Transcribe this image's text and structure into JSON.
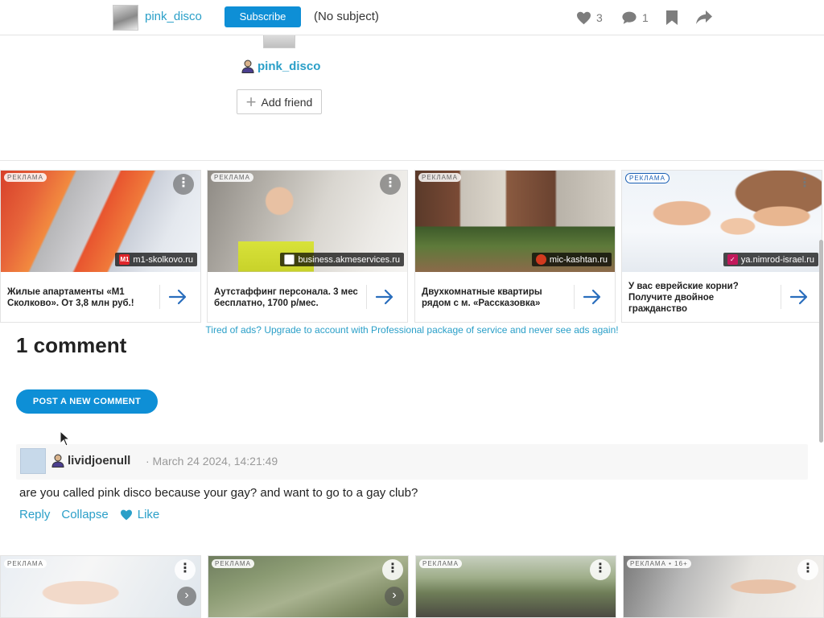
{
  "topbar": {
    "username": "pink_disco",
    "subscribe_label": "Subscribe",
    "subject": "(No subject)",
    "likes_count": "3",
    "comments_count": "1",
    "icons": [
      "heart-icon",
      "comment-icon",
      "bookmark-icon",
      "share-icon"
    ]
  },
  "profile": {
    "name": "pink_disco",
    "add_friend_label": "Add friend"
  },
  "ads": [
    {
      "tag": "РЕКЛАМА",
      "domain": "m1-skolkovo.ru",
      "logo": "M1",
      "logo_color": "#e0242b",
      "title": "Жилые апартаменты «М1 Сколково». От 3,8 млн руб.!"
    },
    {
      "tag": "РЕКЛАМА",
      "domain": "business.akmeservices.ru",
      "logo": "",
      "logo_color": "#ffffff",
      "title": "Аутстаффинг персонала. 3 мес бесплатно, 1700 р/мес."
    },
    {
      "tag": "РЕКЛАМА",
      "domain": "mic-kashtan.ru",
      "logo": "",
      "logo_color": "#d23a1e",
      "title": "Двухкомнатные квартиры рядом с м. «Рассказовка»"
    },
    {
      "tag": "РЕКЛАМА",
      "domain": "ya.nimrod-israel.ru",
      "logo": "✓",
      "logo_color": "#c2185b",
      "title": "У вас еврейские корни? Получите двойное гражданство"
    }
  ],
  "ad_note": "Tired of ads? Upgrade to account with Professional package of service and never see ads again!",
  "comments": {
    "title": "1 comment",
    "post_button": "POST A NEW COMMENT",
    "items": [
      {
        "author": "lividjoenull",
        "date": "· March 24 2024, 14:21:49",
        "text": "are you called pink disco because your gay? and want to go to a gay club?",
        "reply": "Reply",
        "collapse": "Collapse",
        "like": "Like"
      }
    ]
  },
  "bottom_ads": [
    {
      "tag": "РЕКЛАМА"
    },
    {
      "tag": "РЕКЛАМА"
    },
    {
      "tag": "РЕКЛАМА"
    },
    {
      "tag": "РЕКЛАМА • 16+"
    }
  ],
  "colors": {
    "accent": "#0e8fd6",
    "link": "#2a9fc8"
  }
}
